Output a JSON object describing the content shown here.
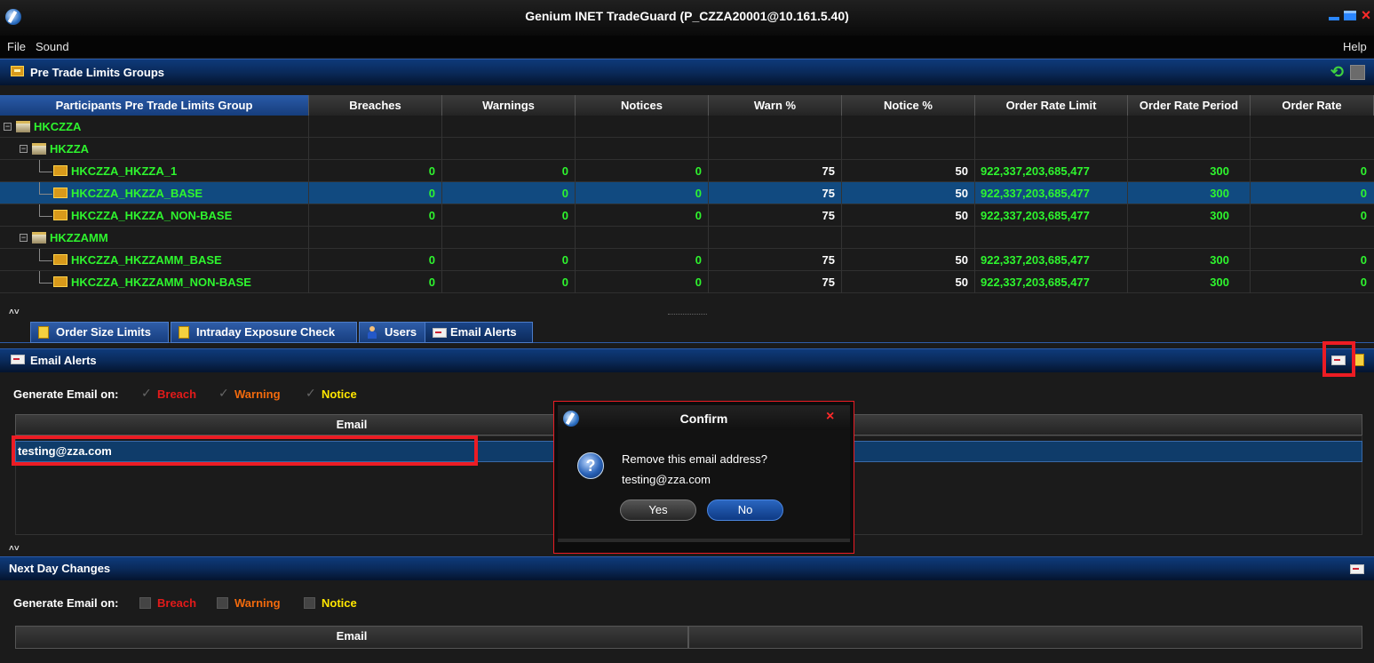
{
  "window": {
    "title": "Genium INET TradeGuard (P_CZZA20001@10.161.5.40)"
  },
  "menu": {
    "file": "File",
    "sound": "Sound",
    "help": "Help"
  },
  "groups_panel": {
    "title": "Pre Trade Limits Groups",
    "columns": [
      "Participants Pre Trade Limits Group",
      "Breaches",
      "Warnings",
      "Notices",
      "Warn %",
      "Notice %",
      "Order Rate Limit",
      "Order Rate Period",
      "Order Rate"
    ],
    "rows": [
      {
        "name": "HKCZZA",
        "level": 0,
        "type": "participant"
      },
      {
        "name": "HKZZA",
        "level": 1,
        "type": "participant"
      },
      {
        "name": "HKCZZA_HKZZA_1",
        "level": 2,
        "type": "group",
        "values": [
          "0",
          "0",
          "0",
          "75",
          "50",
          "922,337,203,685,477",
          "300",
          "0"
        ]
      },
      {
        "name": "HKCZZA_HKZZA_BASE",
        "level": 2,
        "type": "group",
        "selected": true,
        "values": [
          "0",
          "0",
          "0",
          "75",
          "50",
          "922,337,203,685,477",
          "300",
          "0"
        ]
      },
      {
        "name": "HKCZZA_HKZZA_NON-BASE",
        "level": 2,
        "type": "group",
        "values": [
          "0",
          "0",
          "0",
          "75",
          "50",
          "922,337,203,685,477",
          "300",
          "0"
        ]
      },
      {
        "name": "HKZZAMM",
        "level": 1,
        "type": "participant"
      },
      {
        "name": "HKCZZA_HKZZAMM_BASE",
        "level": 2,
        "type": "group",
        "values": [
          "0",
          "0",
          "0",
          "75",
          "50",
          "922,337,203,685,477",
          "300",
          "0"
        ]
      },
      {
        "name": "HKCZZA_HKZZAMM_NON-BASE",
        "level": 2,
        "type": "group",
        "values": [
          "0",
          "0",
          "0",
          "75",
          "50",
          "922,337,203,685,477",
          "300",
          "0"
        ]
      }
    ]
  },
  "tabs": [
    "Order Size Limits",
    "Intraday Exposure Check",
    "Users",
    "Email Alerts"
  ],
  "active_tab": "Email Alerts",
  "email_alerts": {
    "title": "Email Alerts",
    "generate_label": "Generate Email on:",
    "options": {
      "breach": "Breach",
      "warning": "Warning",
      "notice": "Notice"
    },
    "checked": {
      "breach": true,
      "warning": true,
      "notice": true
    },
    "column": "Email",
    "emails": [
      "testing@zza.com"
    ]
  },
  "next_day": {
    "title": "Next Day Changes",
    "generate_label": "Generate Email on:",
    "options": {
      "breach": "Breach",
      "warning": "Warning",
      "notice": "Notice"
    },
    "checked": {
      "breach": false,
      "warning": false,
      "notice": false
    },
    "column": "Email"
  },
  "dialog": {
    "title": "Confirm",
    "message": "Remove this email address?",
    "detail": "testing@zza.com",
    "yes": "Yes",
    "no": "No"
  },
  "colors": {
    "accent_blue": "#114a80",
    "value_green": "#2ef52e",
    "breach_red": "#e21a1a",
    "warning_orange": "#f26a0d",
    "notice_yellow": "#ffe600",
    "highlight_red": "#ec1c24"
  }
}
